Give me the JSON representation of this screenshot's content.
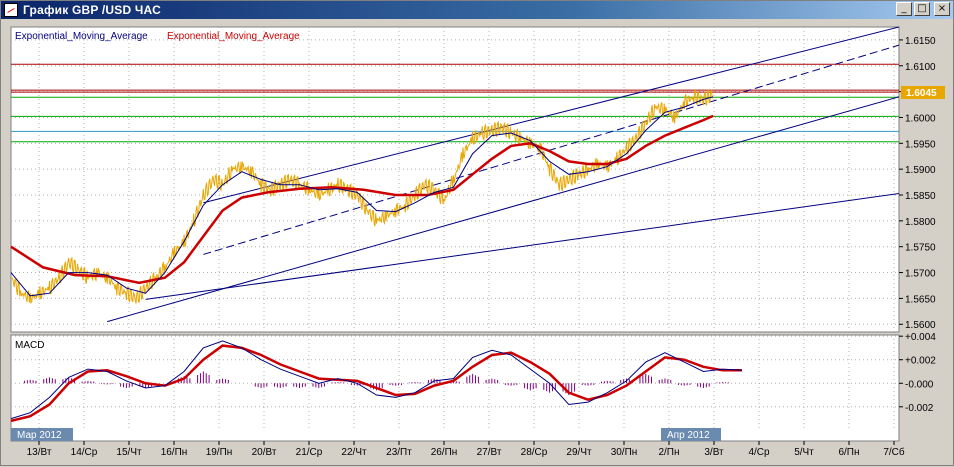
{
  "window": {
    "title": "График GBP /USD ЧАС",
    "buttons": [
      "_",
      "□",
      "×"
    ]
  },
  "legend": {
    "ema1_label": "Exponential_Moving_Average",
    "ema2_label": "Exponential_Moving_Average"
  },
  "macd_label": "MACD",
  "current_price": "1.6045",
  "month_labels": [
    "Мар 2012",
    "Апр 2012"
  ],
  "colors": {
    "price": "#e8a600",
    "ema_fast": "#000080",
    "ema_slow": "#cc0000",
    "channel": "#000080",
    "hline_red": "#aa0000",
    "hline_green": "#00aa00",
    "hline_cyan": "#3399cc",
    "histogram": "#800080",
    "price_badge": "#e8a600"
  },
  "chart_data": [
    {
      "type": "line",
      "title": "",
      "series_names": [
        "Exponential_Moving_Average",
        "Exponential_Moving_Average"
      ],
      "x_tick_labels": [
        "13/Вт",
        "14/Ср",
        "15/Чт",
        "16/Пн",
        "19/Пн",
        "20/Вт",
        "21/Ср",
        "22/Чт",
        "23/Пт",
        "26/Пн",
        "27/Вт",
        "28/Ср",
        "29/Чт",
        "30/Пн",
        "2/Пн",
        "3/Вт",
        "4/Ср",
        "5/Чт",
        "6/Пн",
        "7/Сб"
      ],
      "y_ticks": [
        "1.5600",
        "1.5650",
        "1.5700",
        "1.5750",
        "1.5800",
        "1.5850",
        "1.5900",
        "1.5950",
        "1.6000",
        "1.6050",
        "1.6100",
        "1.6150"
      ],
      "ylim": [
        1.5585,
        1.6175
      ],
      "grid": true,
      "horizontal_levels": [
        {
          "value": 1.6103,
          "color": "red"
        },
        {
          "value": 1.6053,
          "color": "red"
        },
        {
          "value": 1.6049,
          "color": "red"
        },
        {
          "value": 1.6039,
          "color": "green"
        },
        {
          "value": 1.6002,
          "color": "green"
        },
        {
          "value": 1.5973,
          "color": "cyan"
        },
        {
          "value": 1.5953,
          "color": "green"
        }
      ],
      "price_points": [
        [
          0,
          1.569
        ],
        [
          3,
          1.566
        ],
        [
          6,
          1.565
        ],
        [
          9,
          1.566
        ],
        [
          12,
          1.567
        ],
        [
          15,
          1.569
        ],
        [
          18,
          1.572
        ],
        [
          21,
          1.5705
        ],
        [
          24,
          1.569
        ],
        [
          27,
          1.57
        ],
        [
          30,
          1.569
        ],
        [
          33,
          1.567
        ],
        [
          36,
          1.566
        ],
        [
          39,
          1.565
        ],
        [
          42,
          1.567
        ],
        [
          45,
          1.569
        ],
        [
          48,
          1.571
        ],
        [
          51,
          1.574
        ],
        [
          54,
          1.576
        ],
        [
          57,
          1.58
        ],
        [
          60,
          1.585
        ],
        [
          63,
          1.588
        ],
        [
          66,
          1.587
        ],
        [
          69,
          1.59
        ],
        [
          72,
          1.5905
        ],
        [
          75,
          1.5895
        ],
        [
          78,
          1.587
        ],
        [
          81,
          1.586
        ],
        [
          84,
          1.587
        ],
        [
          87,
          1.588
        ],
        [
          90,
          1.587
        ],
        [
          93,
          1.586
        ],
        [
          96,
          1.585
        ],
        [
          99,
          1.586
        ],
        [
          102,
          1.587
        ],
        [
          105,
          1.586
        ],
        [
          108,
          1.585
        ],
        [
          111,
          1.582
        ],
        [
          114,
          1.58
        ],
        [
          117,
          1.581
        ],
        [
          120,
          1.582
        ],
        [
          123,
          1.583
        ],
        [
          126,
          1.585
        ],
        [
          129,
          1.587
        ],
        [
          132,
          1.586
        ],
        [
          135,
          1.584
        ],
        [
          138,
          1.588
        ],
        [
          141,
          1.593
        ],
        [
          144,
          1.596
        ],
        [
          147,
          1.597
        ],
        [
          150,
          1.5975
        ],
        [
          153,
          1.598
        ],
        [
          156,
          1.597
        ],
        [
          159,
          1.596
        ],
        [
          162,
          1.595
        ],
        [
          165,
          1.594
        ],
        [
          168,
          1.59
        ],
        [
          171,
          1.587
        ],
        [
          174,
          1.588
        ],
        [
          177,
          1.589
        ],
        [
          180,
          1.59
        ],
        [
          183,
          1.591
        ],
        [
          186,
          1.5905
        ],
        [
          189,
          1.592
        ],
        [
          192,
          1.594
        ],
        [
          195,
          1.596
        ],
        [
          198,
          1.599
        ],
        [
          201,
          1.602
        ],
        [
          204,
          1.6015
        ],
        [
          207,
          1.6
        ],
        [
          210,
          1.603
        ],
        [
          213,
          1.604
        ],
        [
          216,
          1.6035
        ],
        [
          219,
          1.6045
        ]
      ],
      "ema_fast_points": [
        [
          0,
          1.57
        ],
        [
          6,
          1.5655
        ],
        [
          12,
          1.566
        ],
        [
          18,
          1.57
        ],
        [
          24,
          1.57
        ],
        [
          30,
          1.5695
        ],
        [
          36,
          1.567
        ],
        [
          42,
          1.566
        ],
        [
          48,
          1.57
        ],
        [
          54,
          1.576
        ],
        [
          60,
          1.583
        ],
        [
          66,
          1.587
        ],
        [
          72,
          1.5895
        ],
        [
          78,
          1.588
        ],
        [
          84,
          1.587
        ],
        [
          90,
          1.587
        ],
        [
          96,
          1.586
        ],
        [
          102,
          1.5862
        ],
        [
          108,
          1.5855
        ],
        [
          114,
          1.582
        ],
        [
          120,
          1.5818
        ],
        [
          126,
          1.5835
        ],
        [
          132,
          1.5855
        ],
        [
          138,
          1.5865
        ],
        [
          144,
          1.593
        ],
        [
          150,
          1.5965
        ],
        [
          156,
          1.597
        ],
        [
          162,
          1.5955
        ],
        [
          168,
          1.5915
        ],
        [
          174,
          1.589
        ],
        [
          180,
          1.5895
        ],
        [
          186,
          1.5905
        ],
        [
          192,
          1.593
        ],
        [
          198,
          1.5975
        ],
        [
          204,
          1.601
        ],
        [
          210,
          1.602
        ],
        [
          216,
          1.6035
        ],
        [
          219,
          1.604
        ]
      ],
      "ema_slow_points": [
        [
          0,
          1.575
        ],
        [
          10,
          1.571
        ],
        [
          20,
          1.5695
        ],
        [
          30,
          1.5693
        ],
        [
          40,
          1.568
        ],
        [
          48,
          1.569
        ],
        [
          54,
          1.572
        ],
        [
          60,
          1.577
        ],
        [
          66,
          1.582
        ],
        [
          72,
          1.5845
        ],
        [
          80,
          1.5855
        ],
        [
          90,
          1.5862
        ],
        [
          100,
          1.5865
        ],
        [
          110,
          1.586
        ],
        [
          120,
          1.585
        ],
        [
          130,
          1.585
        ],
        [
          138,
          1.586
        ],
        [
          144,
          1.589
        ],
        [
          150,
          1.592
        ],
        [
          156,
          1.5945
        ],
        [
          162,
          1.595
        ],
        [
          168,
          1.5935
        ],
        [
          174,
          1.5915
        ],
        [
          180,
          1.591
        ],
        [
          186,
          1.591
        ],
        [
          192,
          1.592
        ],
        [
          198,
          1.5945
        ],
        [
          204,
          1.5965
        ],
        [
          210,
          1.598
        ],
        [
          216,
          1.5995
        ],
        [
          219,
          1.6003
        ]
      ],
      "channel_lines": [
        {
          "from": [
            30,
            1.5605
          ],
          "to": [
            277,
            1.604
          ],
          "style": "solid"
        },
        {
          "from": [
            60,
            1.5835
          ],
          "to": [
            277,
            1.6175
          ],
          "style": "solid"
        },
        {
          "from": [
            60,
            1.5735
          ],
          "to": [
            277,
            1.614
          ],
          "style": "dashed"
        },
        {
          "from": [
            42,
            1.5648
          ],
          "to": [
            277,
            1.5853
          ],
          "style": "solid"
        }
      ],
      "x_range": [
        0,
        277
      ]
    },
    {
      "type": "line",
      "title": "MACD",
      "y_ticks": [
        "+0.004",
        "+0.002",
        "-0.000",
        "-0.002"
      ],
      "ylim": [
        -0.0038,
        0.0041
      ],
      "grid": true,
      "macd_line": [
        [
          0,
          -0.003
        ],
        [
          6,
          -0.0025
        ],
        [
          12,
          -0.0012
        ],
        [
          18,
          0.0005
        ],
        [
          24,
          0.0012
        ],
        [
          30,
          0.001
        ],
        [
          36,
          0.0002
        ],
        [
          42,
          -0.0004
        ],
        [
          48,
          -0.0002
        ],
        [
          54,
          0.001
        ],
        [
          60,
          0.003
        ],
        [
          66,
          0.0036
        ],
        [
          72,
          0.003
        ],
        [
          78,
          0.002
        ],
        [
          84,
          0.0012
        ],
        [
          90,
          0.0006
        ],
        [
          96,
          0.0
        ],
        [
          102,
          0.0004
        ],
        [
          108,
          0.0
        ],
        [
          114,
          -0.001
        ],
        [
          120,
          -0.0012
        ],
        [
          126,
          -0.0008
        ],
        [
          132,
          0.0002
        ],
        [
          138,
          0.0004
        ],
        [
          144,
          0.0022
        ],
        [
          150,
          0.0028
        ],
        [
          156,
          0.0024
        ],
        [
          162,
          0.0012
        ],
        [
          168,
          0.0
        ],
        [
          174,
          -0.0018
        ],
        [
          180,
          -0.0016
        ],
        [
          186,
          -0.0008
        ],
        [
          192,
          0.0002
        ],
        [
          198,
          0.0018
        ],
        [
          204,
          0.0026
        ],
        [
          210,
          0.0018
        ],
        [
          216,
          0.001
        ],
        [
          222,
          0.0012
        ],
        [
          228,
          0.0011
        ]
      ],
      "signal_line": [
        [
          0,
          -0.0032
        ],
        [
          6,
          -0.0028
        ],
        [
          12,
          -0.0018
        ],
        [
          18,
          0.0
        ],
        [
          24,
          0.001
        ],
        [
          30,
          0.0011
        ],
        [
          36,
          0.0006
        ],
        [
          42,
          0.0
        ],
        [
          48,
          -0.0002
        ],
        [
          54,
          0.0004
        ],
        [
          60,
          0.002
        ],
        [
          66,
          0.0032
        ],
        [
          72,
          0.003
        ],
        [
          78,
          0.0024
        ],
        [
          84,
          0.0016
        ],
        [
          90,
          0.001
        ],
        [
          96,
          0.0004
        ],
        [
          102,
          0.0003
        ],
        [
          108,
          0.0002
        ],
        [
          114,
          -0.0004
        ],
        [
          120,
          -0.001
        ],
        [
          126,
          -0.0009
        ],
        [
          132,
          -0.0002
        ],
        [
          138,
          0.0002
        ],
        [
          144,
          0.0014
        ],
        [
          150,
          0.0024
        ],
        [
          156,
          0.0026
        ],
        [
          162,
          0.0018
        ],
        [
          168,
          0.0008
        ],
        [
          174,
          -0.0008
        ],
        [
          180,
          -0.0014
        ],
        [
          186,
          -0.001
        ],
        [
          192,
          -0.0002
        ],
        [
          198,
          0.001
        ],
        [
          204,
          0.0022
        ],
        [
          210,
          0.002
        ],
        [
          216,
          0.0014
        ],
        [
          222,
          0.0011
        ],
        [
          228,
          0.0011
        ]
      ],
      "histogram": [
        [
          6,
          0.0003
        ],
        [
          12,
          0.0005
        ],
        [
          18,
          0.0005
        ],
        [
          24,
          0.0002
        ],
        [
          30,
          -0.0001
        ],
        [
          36,
          -0.0004
        ],
        [
          42,
          -0.0004
        ],
        [
          48,
          0.0
        ],
        [
          54,
          0.0006
        ],
        [
          60,
          0.001
        ],
        [
          66,
          0.0004
        ],
        [
          72,
          0.0
        ],
        [
          78,
          -0.0004
        ],
        [
          84,
          -0.0004
        ],
        [
          90,
          -0.0004
        ],
        [
          96,
          -0.0004
        ],
        [
          102,
          0.0001
        ],
        [
          108,
          -0.0002
        ],
        [
          114,
          -0.0006
        ],
        [
          120,
          -0.0002
        ],
        [
          126,
          0.0001
        ],
        [
          132,
          0.0004
        ],
        [
          138,
          0.0002
        ],
        [
          144,
          0.0008
        ],
        [
          150,
          0.0004
        ],
        [
          156,
          -0.0002
        ],
        [
          162,
          -0.0006
        ],
        [
          168,
          -0.0008
        ],
        [
          174,
          -0.001
        ],
        [
          180,
          -0.0002
        ],
        [
          186,
          0.0002
        ],
        [
          192,
          0.0004
        ],
        [
          198,
          0.0008
        ],
        [
          204,
          0.0004
        ],
        [
          210,
          -0.0002
        ],
        [
          216,
          -0.0004
        ],
        [
          222,
          0.0001
        ]
      ]
    }
  ]
}
